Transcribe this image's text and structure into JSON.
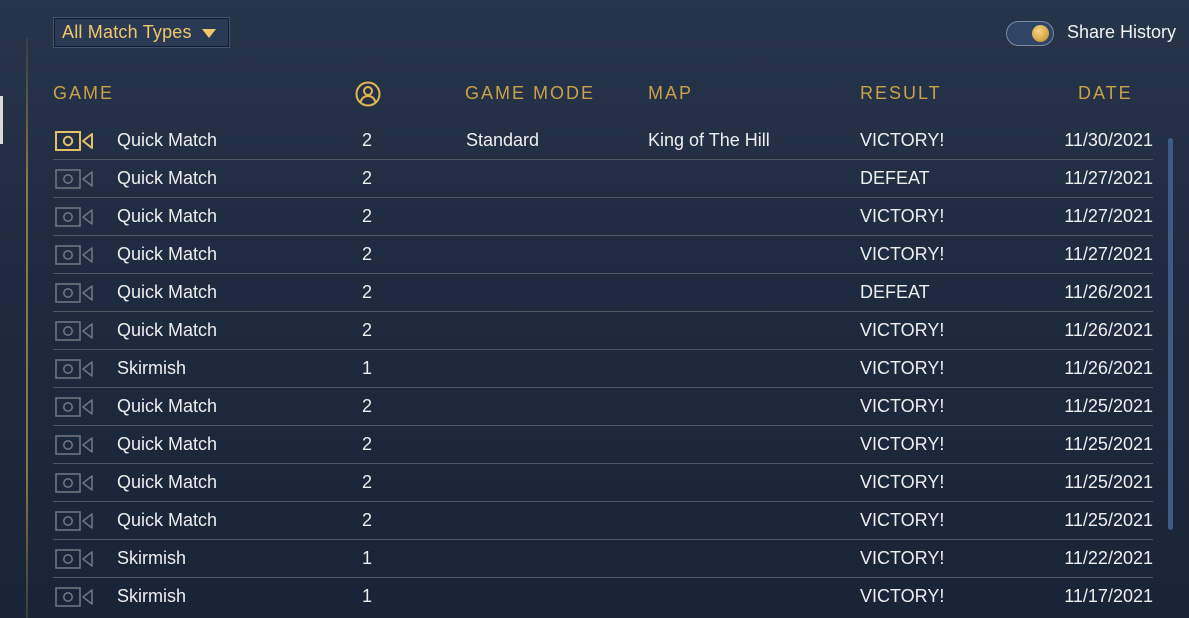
{
  "filter": {
    "label": "All Match Types",
    "caret_icon": "caret-down-icon"
  },
  "share_history": {
    "label": "Share History",
    "enabled": true
  },
  "columns": {
    "game": "GAME",
    "players_icon": "player-count-icon",
    "game_mode": "GAME MODE",
    "map": "MAP",
    "result": "RESULT",
    "date": "DATE"
  },
  "rows": [
    {
      "game": "Quick Match",
      "players": "2",
      "mode": "Standard",
      "map": "King of The Hill",
      "result": "VICTORY!",
      "date": "11/30/2021",
      "replay_active": true
    },
    {
      "game": "Quick Match",
      "players": "2",
      "mode": "",
      "map": "",
      "result": "DEFEAT",
      "date": "11/27/2021",
      "replay_active": false
    },
    {
      "game": "Quick Match",
      "players": "2",
      "mode": "",
      "map": "",
      "result": "VICTORY!",
      "date": "11/27/2021",
      "replay_active": false
    },
    {
      "game": "Quick Match",
      "players": "2",
      "mode": "",
      "map": "",
      "result": "VICTORY!",
      "date": "11/27/2021",
      "replay_active": false
    },
    {
      "game": "Quick Match",
      "players": "2",
      "mode": "",
      "map": "",
      "result": "DEFEAT",
      "date": "11/26/2021",
      "replay_active": false
    },
    {
      "game": "Quick Match",
      "players": "2",
      "mode": "",
      "map": "",
      "result": "VICTORY!",
      "date": "11/26/2021",
      "replay_active": false
    },
    {
      "game": "Skirmish",
      "players": "1",
      "mode": "",
      "map": "",
      "result": "VICTORY!",
      "date": "11/26/2021",
      "replay_active": false
    },
    {
      "game": "Quick Match",
      "players": "2",
      "mode": "",
      "map": "",
      "result": "VICTORY!",
      "date": "11/25/2021",
      "replay_active": false
    },
    {
      "game": "Quick Match",
      "players": "2",
      "mode": "",
      "map": "",
      "result": "VICTORY!",
      "date": "11/25/2021",
      "replay_active": false
    },
    {
      "game": "Quick Match",
      "players": "2",
      "mode": "",
      "map": "",
      "result": "VICTORY!",
      "date": "11/25/2021",
      "replay_active": false
    },
    {
      "game": "Quick Match",
      "players": "2",
      "mode": "",
      "map": "",
      "result": "VICTORY!",
      "date": "11/25/2021",
      "replay_active": false
    },
    {
      "game": "Skirmish",
      "players": "1",
      "mode": "",
      "map": "",
      "result": "VICTORY!",
      "date": "11/22/2021",
      "replay_active": false
    },
    {
      "game": "Skirmish",
      "players": "1",
      "mode": "",
      "map": "",
      "result": "VICTORY!",
      "date": "11/17/2021",
      "replay_active": false
    }
  ],
  "colors": {
    "accent_gold": "#c9a14a",
    "replay_active": "#e3bf6a",
    "replay_inactive": "#6e7480"
  }
}
